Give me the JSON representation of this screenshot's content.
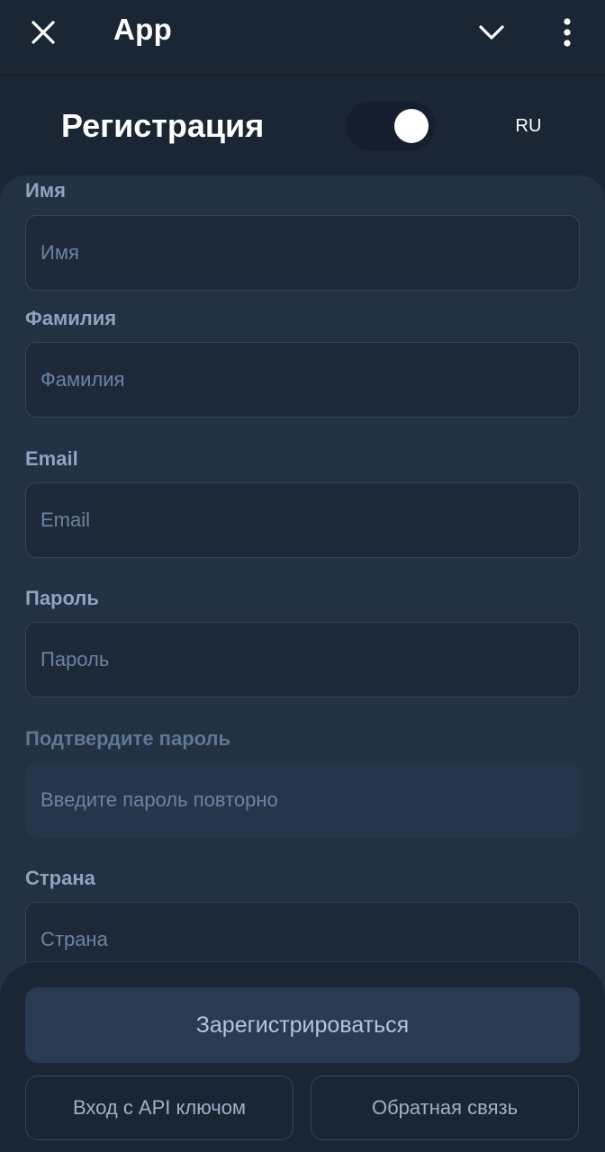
{
  "appbar": {
    "title": "App",
    "icons": {
      "close": "close-icon",
      "chevron": "chevron-down-icon",
      "menu": "more-vertical-icon"
    }
  },
  "header": {
    "title": "Регистрация",
    "toggle_on": true,
    "language": "RU"
  },
  "form": {
    "first_name": {
      "label": "Имя",
      "placeholder": "Имя",
      "value": ""
    },
    "last_name": {
      "label": "Фамилия",
      "placeholder": "Фамилия",
      "value": ""
    },
    "email": {
      "label": "Email",
      "placeholder": "Email",
      "value": ""
    },
    "password": {
      "label": "Пароль",
      "placeholder": "Пароль",
      "value": ""
    },
    "confirm_password": {
      "label": "Подтвердите пароль",
      "placeholder": "Введите пароль повторно",
      "value": "",
      "disabled": true
    },
    "country": {
      "label": "Страна",
      "placeholder": "Страна",
      "value": ""
    }
  },
  "actions": {
    "register": "Зарегистрироваться",
    "api_login": "Вход с API ключом",
    "feedback": "Обратная связь"
  },
  "colors": {
    "background": "#1b2634",
    "card": "#223143",
    "input": "#1d2938",
    "label": "#8fa4c0",
    "toggle_track": "#141e2e"
  }
}
